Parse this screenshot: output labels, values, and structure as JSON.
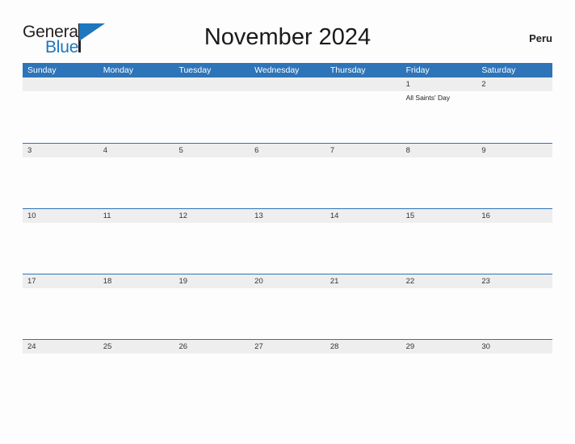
{
  "brand": {
    "name_part1": "General",
    "name_part2": "Blue",
    "accent_color": "#1e76bd",
    "logo_icon": "blue-triangle-flag-icon"
  },
  "header": {
    "title": "November 2024",
    "country": "Peru"
  },
  "calendar": {
    "header_background": "#2e74b8",
    "day_band_background": "#eeeeee",
    "weekdays": [
      "Sunday",
      "Monday",
      "Tuesday",
      "Wednesday",
      "Thursday",
      "Friday",
      "Saturday"
    ],
    "weeks": [
      [
        {
          "day": "",
          "events": []
        },
        {
          "day": "",
          "events": []
        },
        {
          "day": "",
          "events": []
        },
        {
          "day": "",
          "events": []
        },
        {
          "day": "",
          "events": []
        },
        {
          "day": "1",
          "events": [
            "All Saints' Day"
          ]
        },
        {
          "day": "2",
          "events": []
        }
      ],
      [
        {
          "day": "3",
          "events": []
        },
        {
          "day": "4",
          "events": []
        },
        {
          "day": "5",
          "events": []
        },
        {
          "day": "6",
          "events": []
        },
        {
          "day": "7",
          "events": []
        },
        {
          "day": "8",
          "events": []
        },
        {
          "day": "9",
          "events": []
        }
      ],
      [
        {
          "day": "10",
          "events": []
        },
        {
          "day": "11",
          "events": []
        },
        {
          "day": "12",
          "events": []
        },
        {
          "day": "13",
          "events": []
        },
        {
          "day": "14",
          "events": []
        },
        {
          "day": "15",
          "events": []
        },
        {
          "day": "16",
          "events": []
        }
      ],
      [
        {
          "day": "17",
          "events": []
        },
        {
          "day": "18",
          "events": []
        },
        {
          "day": "19",
          "events": []
        },
        {
          "day": "20",
          "events": []
        },
        {
          "day": "21",
          "events": []
        },
        {
          "day": "22",
          "events": []
        },
        {
          "day": "23",
          "events": []
        }
      ],
      [
        {
          "day": "24",
          "events": []
        },
        {
          "day": "25",
          "events": []
        },
        {
          "day": "26",
          "events": []
        },
        {
          "day": "27",
          "events": []
        },
        {
          "day": "28",
          "events": []
        },
        {
          "day": "29",
          "events": []
        },
        {
          "day": "30",
          "events": []
        }
      ]
    ]
  }
}
